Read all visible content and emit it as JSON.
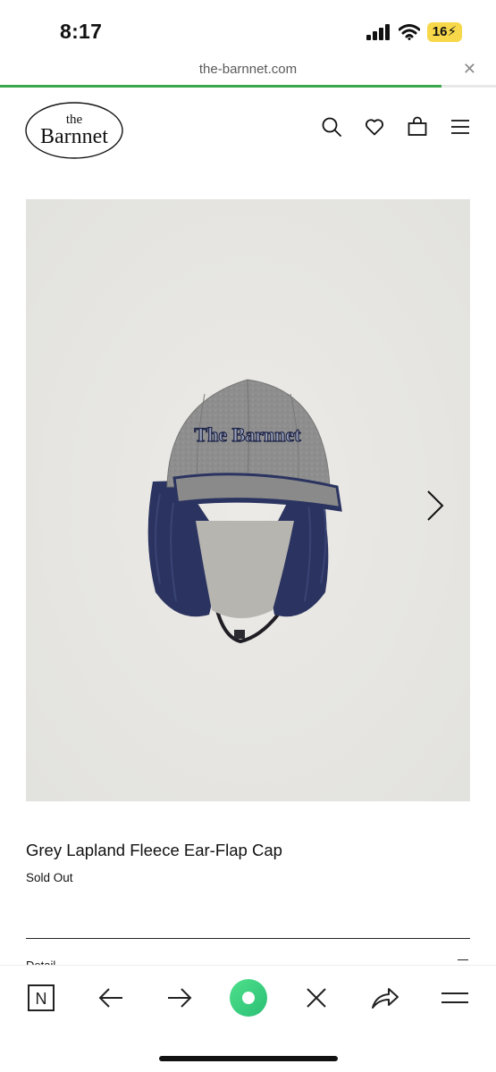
{
  "status_bar": {
    "time": "8:17",
    "battery": "16"
  },
  "browser": {
    "url": "the-barnnet.com",
    "close_label": "✕",
    "load_progress": 0.89,
    "accent_color": "#3aa84a"
  },
  "site": {
    "logo_small": "the",
    "logo_large": "Barnnet",
    "header_icons": [
      "search-icon",
      "heart-icon",
      "bag-icon",
      "menu-icon"
    ]
  },
  "product": {
    "title": "Grey Lapland Fleece Ear-Flap Cap",
    "status": "Sold Out",
    "cap_embroidery": "The Barnnet",
    "detail_label": "Detail"
  },
  "toolbar": {
    "items": [
      "n-logo-icon",
      "back-arrow-icon",
      "forward-arrow-icon",
      "circle-record-icon",
      "close-icon",
      "share-icon",
      "menu-icon"
    ],
    "logo_letter": "N"
  }
}
